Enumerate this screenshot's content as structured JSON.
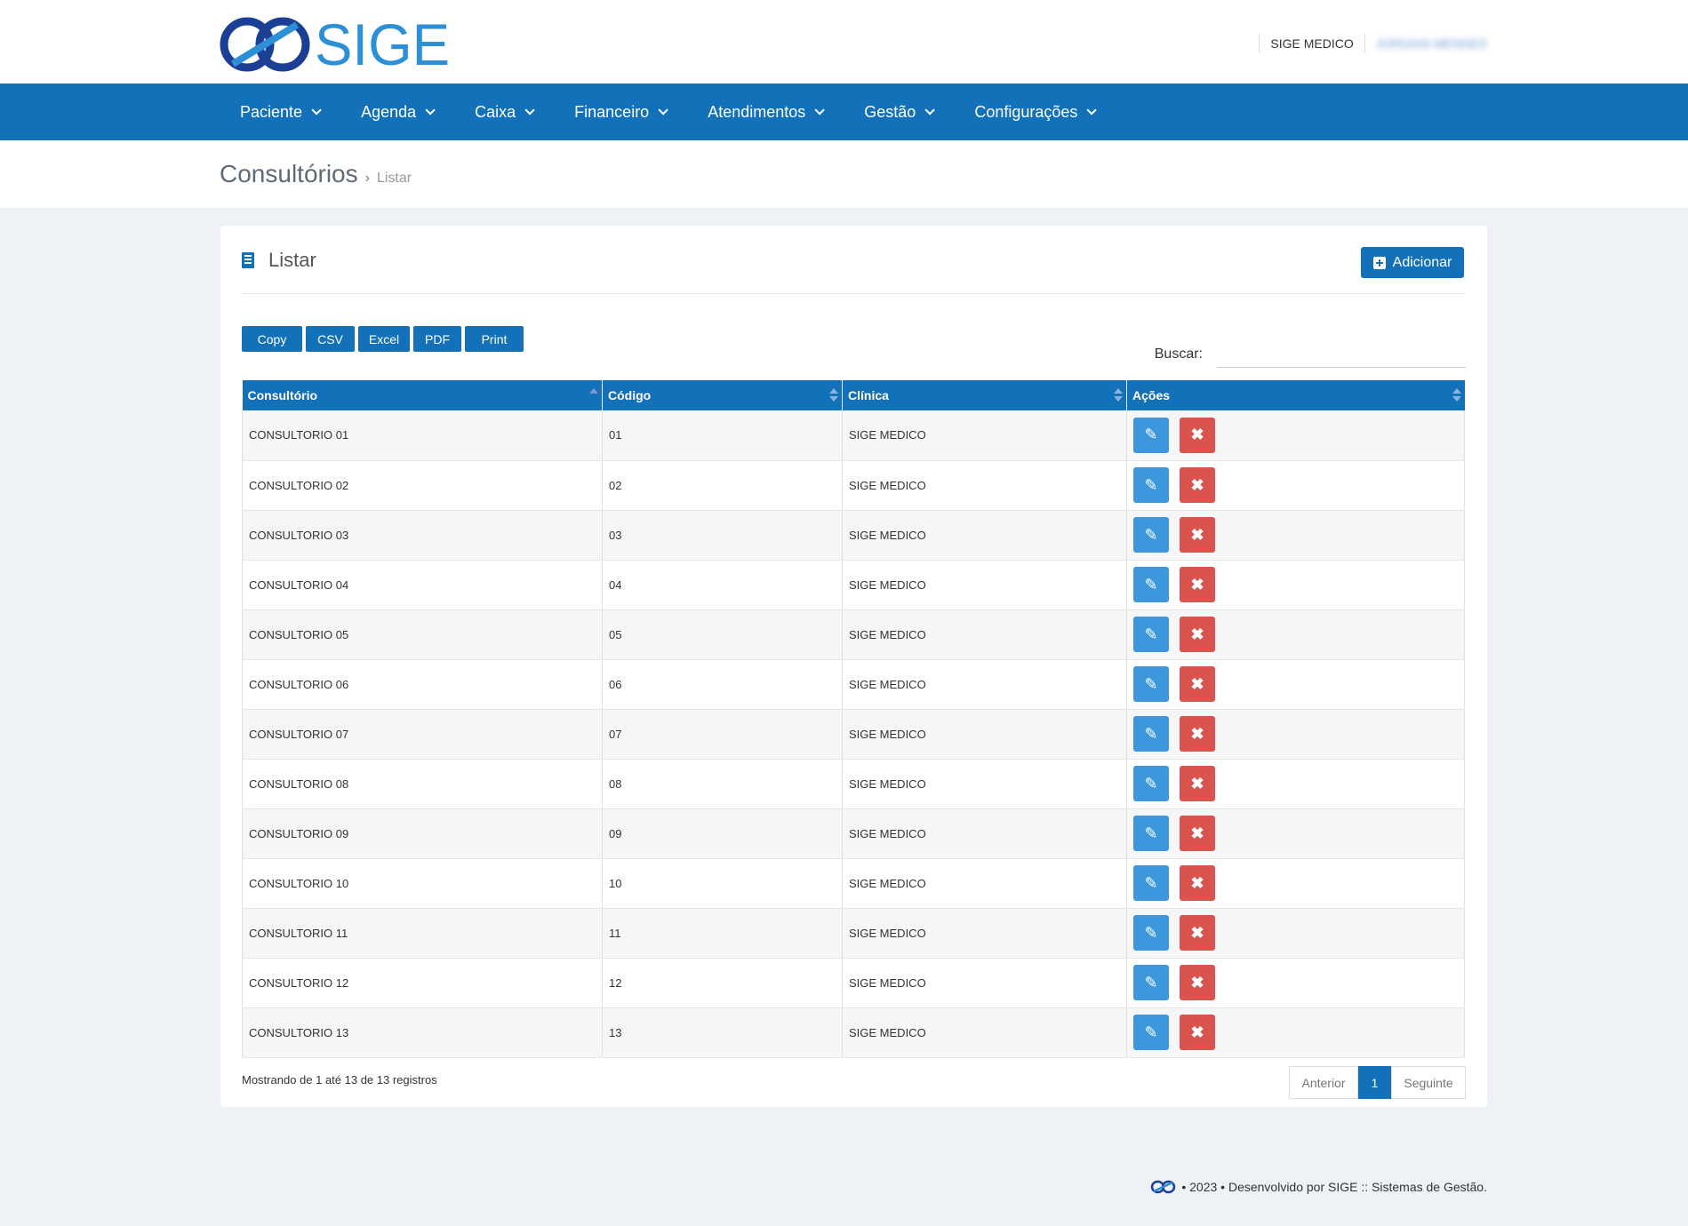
{
  "header": {
    "logo_text": "SIGE",
    "clinic": "SIGE MEDICO",
    "user": "JORDANI MENDES"
  },
  "nav": {
    "items": [
      {
        "label": "Paciente"
      },
      {
        "label": "Agenda"
      },
      {
        "label": "Caixa"
      },
      {
        "label": "Financeiro"
      },
      {
        "label": "Atendimentos"
      },
      {
        "label": "Gestão"
      },
      {
        "label": "Configurações"
      }
    ]
  },
  "breadcrumb": {
    "title": "Consultórios",
    "separator": "›",
    "current": "Listar"
  },
  "panel": {
    "title": "Listar",
    "add_label": "Adicionar"
  },
  "export_buttons": [
    "Copy",
    "CSV",
    "Excel",
    "PDF",
    "Print"
  ],
  "search": {
    "label": "Buscar:",
    "value": ""
  },
  "table": {
    "columns": [
      "Consultório",
      "Código",
      "Clínica",
      "Ações"
    ],
    "rows": [
      {
        "consultorio": "CONSULTORIO 01",
        "codigo": "01",
        "clinica": "SIGE MEDICO"
      },
      {
        "consultorio": "CONSULTORIO 02",
        "codigo": "02",
        "clinica": "SIGE MEDICO"
      },
      {
        "consultorio": "CONSULTORIO 03",
        "codigo": "03",
        "clinica": "SIGE MEDICO"
      },
      {
        "consultorio": "CONSULTORIO 04",
        "codigo": "04",
        "clinica": "SIGE MEDICO"
      },
      {
        "consultorio": "CONSULTORIO 05",
        "codigo": "05",
        "clinica": "SIGE MEDICO"
      },
      {
        "consultorio": "CONSULTORIO 06",
        "codigo": "06",
        "clinica": "SIGE MEDICO"
      },
      {
        "consultorio": "CONSULTORIO 07",
        "codigo": "07",
        "clinica": "SIGE MEDICO"
      },
      {
        "consultorio": "CONSULTORIO 08",
        "codigo": "08",
        "clinica": "SIGE MEDICO"
      },
      {
        "consultorio": "CONSULTORIO 09",
        "codigo": "09",
        "clinica": "SIGE MEDICO"
      },
      {
        "consultorio": "CONSULTORIO 10",
        "codigo": "10",
        "clinica": "SIGE MEDICO"
      },
      {
        "consultorio": "CONSULTORIO 11",
        "codigo": "11",
        "clinica": "SIGE MEDICO"
      },
      {
        "consultorio": "CONSULTORIO 12",
        "codigo": "12",
        "clinica": "SIGE MEDICO"
      },
      {
        "consultorio": "CONSULTORIO 13",
        "codigo": "13",
        "clinica": "SIGE MEDICO"
      }
    ]
  },
  "info": "Mostrando de 1 até 13 de 13 registros",
  "pagination": {
    "prev": "Anterior",
    "current": "1",
    "next": "Seguinte"
  },
  "footer": {
    "text": "• 2023 • Desenvolvido por SIGE :: Sistemas de Gestão."
  },
  "icons": {
    "edit": "pencil-icon",
    "delete": "close-icon",
    "panel": "list-icon",
    "add": "plus-square-icon"
  },
  "colors": {
    "primary": "#1371ba",
    "edit": "#3c97dc",
    "delete": "#d9534f"
  }
}
